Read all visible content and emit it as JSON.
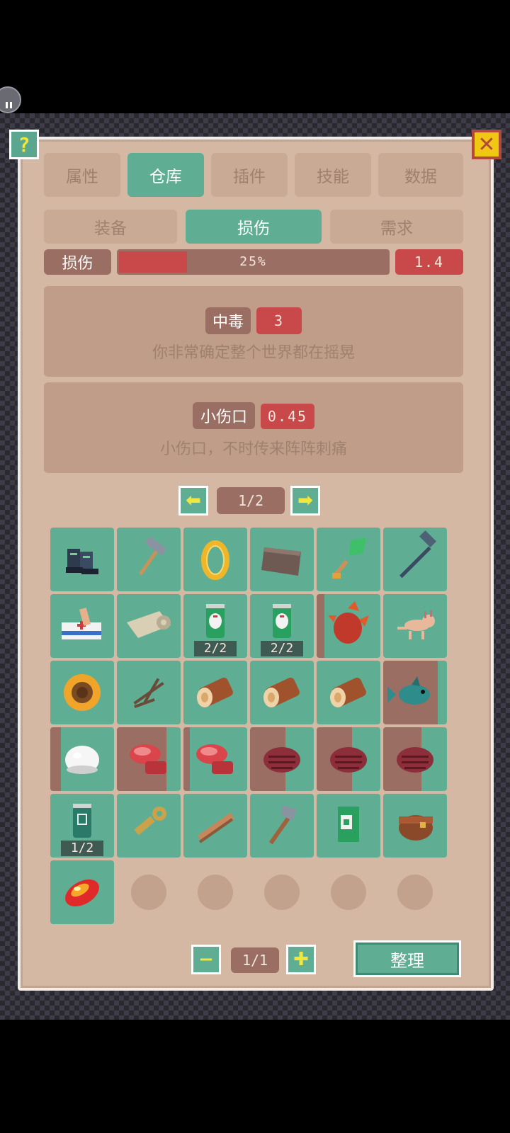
{
  "tabs": [
    {
      "label": "属性",
      "active": false
    },
    {
      "label": "仓库",
      "active": true
    },
    {
      "label": "插件",
      "active": false
    },
    {
      "label": "技能",
      "active": false
    },
    {
      "label": "数据",
      "active": false
    }
  ],
  "subtabs": [
    {
      "label": "装备",
      "active": false
    },
    {
      "label": "损伤",
      "active": true
    },
    {
      "label": "需求",
      "active": false
    }
  ],
  "damage": {
    "label": "损伤",
    "percent_text": "25%",
    "fill_fraction": 0.25,
    "value": "1.4"
  },
  "conditions": [
    {
      "name": "中毒",
      "value": "3",
      "desc": "你非常确定整个世界都在摇晃"
    },
    {
      "name": "小伤口",
      "value": "0.45",
      "desc": "小伤口，不时传来阵阵刺痛"
    }
  ],
  "top_pager": {
    "text": "1/2"
  },
  "bottom_pager": {
    "text": "1/1"
  },
  "tidy_label": "整理",
  "help_glyph": "?",
  "close_glyph": "✕",
  "prev_glyph": "⬅",
  "next_glyph": "➡",
  "minus_glyph": "−",
  "plus_glyph": "✚",
  "items": [
    {
      "icon": "boots-icon",
      "damage": 0
    },
    {
      "icon": "hammer-icon",
      "damage": 0
    },
    {
      "icon": "gold-ring-icon",
      "damage": 0
    },
    {
      "icon": "cloth-icon",
      "damage": 0
    },
    {
      "icon": "shovel-icon",
      "damage": 0
    },
    {
      "icon": "sledgehammer-icon",
      "damage": 0
    },
    {
      "icon": "first-aid-box-icon",
      "damage": 0
    },
    {
      "icon": "bandage-roll-icon",
      "damage": 0
    },
    {
      "icon": "green-can-icon",
      "damage": 0,
      "count": "2/2"
    },
    {
      "icon": "green-can-icon",
      "damage": 0,
      "count": "2/2"
    },
    {
      "icon": "dragonfruit-icon",
      "damage": 0.12
    },
    {
      "icon": "axolotl-icon",
      "damage": 0
    },
    {
      "icon": "sunflower-icon",
      "damage": 0
    },
    {
      "icon": "twigs-icon",
      "damage": 0
    },
    {
      "icon": "log-icon",
      "damage": 0
    },
    {
      "icon": "log-icon",
      "damage": 0
    },
    {
      "icon": "log-icon",
      "damage": 0
    },
    {
      "icon": "fish-icon",
      "damage": 0.85
    },
    {
      "icon": "egg-icon",
      "damage": 0.17
    },
    {
      "icon": "raw-meat-icon",
      "damage": 0.78
    },
    {
      "icon": "raw-meat-icon",
      "damage": 0.1
    },
    {
      "icon": "steak-icon",
      "damage": 0.55
    },
    {
      "icon": "steak-icon",
      "damage": 0.55
    },
    {
      "icon": "steak-icon",
      "damage": 0.6
    },
    {
      "icon": "blue-can-icon",
      "damage": 0,
      "count": "1/2"
    },
    {
      "icon": "key-icon",
      "damage": 0
    },
    {
      "icon": "wood-plank-icon",
      "damage": 0
    },
    {
      "icon": "hatchet-icon",
      "damage": 0
    },
    {
      "icon": "seed-packet-icon",
      "damage": 0
    },
    {
      "icon": "leather-pouch-icon",
      "damage": 0
    },
    {
      "icon": "fire-gem-icon",
      "damage": 0
    }
  ],
  "empty_slots": 5
}
